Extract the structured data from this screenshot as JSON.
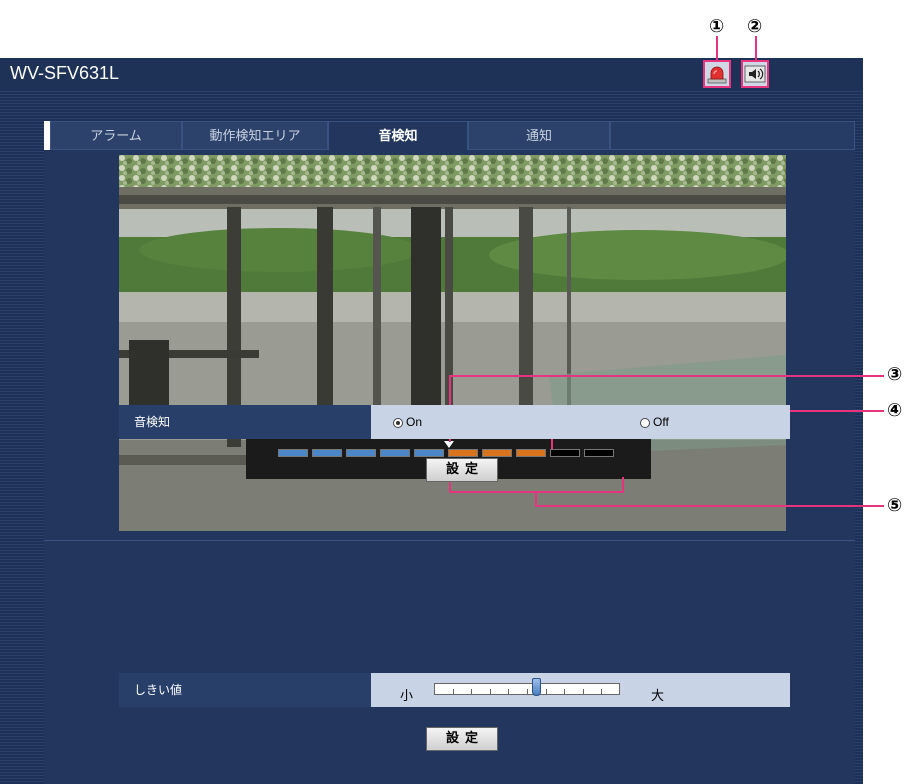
{
  "callouts": [
    "①",
    "②",
    "③",
    "④",
    "⑤"
  ],
  "header": {
    "title": "WV-SFV631L",
    "buttons": [
      {
        "name": "alarm-button",
        "icon": "alarm-lamp-icon"
      },
      {
        "name": "audio-button",
        "icon": "speaker-icon"
      }
    ]
  },
  "tabs": [
    {
      "label": "アラーム"
    },
    {
      "label": "動作検知エリア"
    },
    {
      "label": "音検知",
      "active": true
    },
    {
      "label": "通知"
    }
  ],
  "meter": {
    "value": "5",
    "segments": 10,
    "segment_colors": [
      "#4a86c8",
      "#4a86c8",
      "#4a86c8",
      "#4a86c8",
      "#4a86c8",
      "#d9731c",
      "#d9731c",
      "#d9731c",
      "#000000",
      "#000000"
    ]
  },
  "settings": {
    "sound_detection": {
      "label": "音検知",
      "on_label": "On",
      "off_label": "Off",
      "selected": "On"
    },
    "set_button_1": "設定",
    "threshold": {
      "label": "しきい値",
      "min_label": "小",
      "max_label": "大",
      "position": 0.55
    },
    "set_button_2": "設定"
  },
  "colors": {
    "header_bg": "#1e3156",
    "panel_bg": "#22365e",
    "callout_line": "#e8337f",
    "value_row_bg": "#c8d3e6"
  }
}
